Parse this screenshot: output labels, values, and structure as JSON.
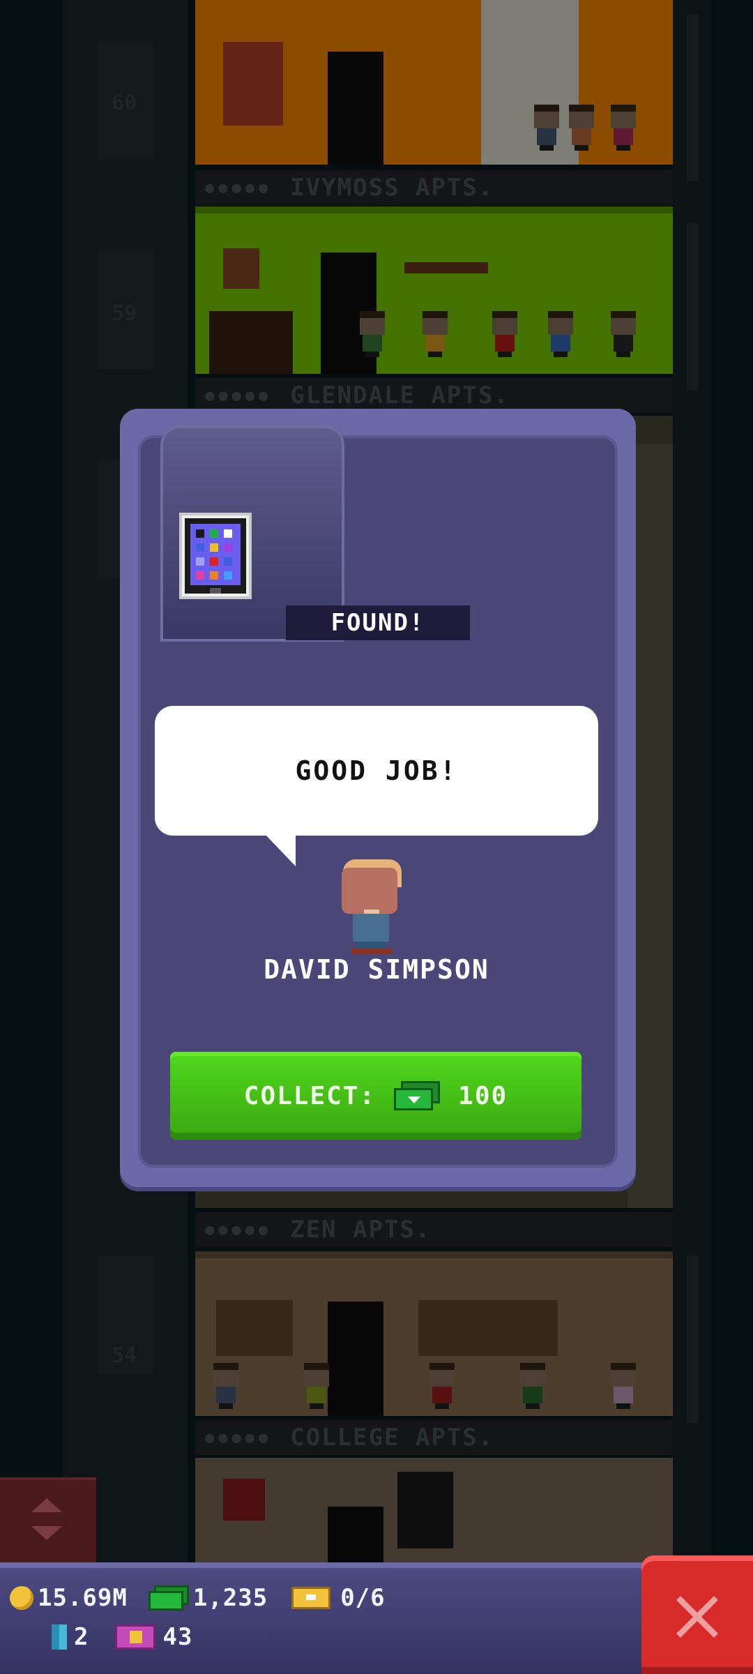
{
  "background": {
    "floors": [
      {
        "number": "60",
        "sign": "IVYMOSS APTS."
      },
      {
        "number": "59",
        "sign": "GLENDALE APTS."
      },
      {
        "number": "",
        "sign": "ZEN APTS."
      },
      {
        "number": "54",
        "sign": "COLLEGE APTS."
      }
    ]
  },
  "dialog": {
    "item_icon": "tablet-icon",
    "status_label": "FOUND!",
    "speech": "GOOD JOB!",
    "character_name": "DAVID SIMPSON",
    "collect": {
      "label": "COLLECT:",
      "currency_icon": "bux-icon",
      "amount": "100"
    }
  },
  "hud": {
    "coins": "15.69M",
    "bux": "1,235",
    "tickets": "0/6",
    "keys": "2",
    "vip": "43"
  },
  "colors": {
    "dialog_frame": "#6d68a8",
    "dialog_inner": "#4b4879",
    "collect_green": "#46c018",
    "close_red": "#d92a2a"
  }
}
